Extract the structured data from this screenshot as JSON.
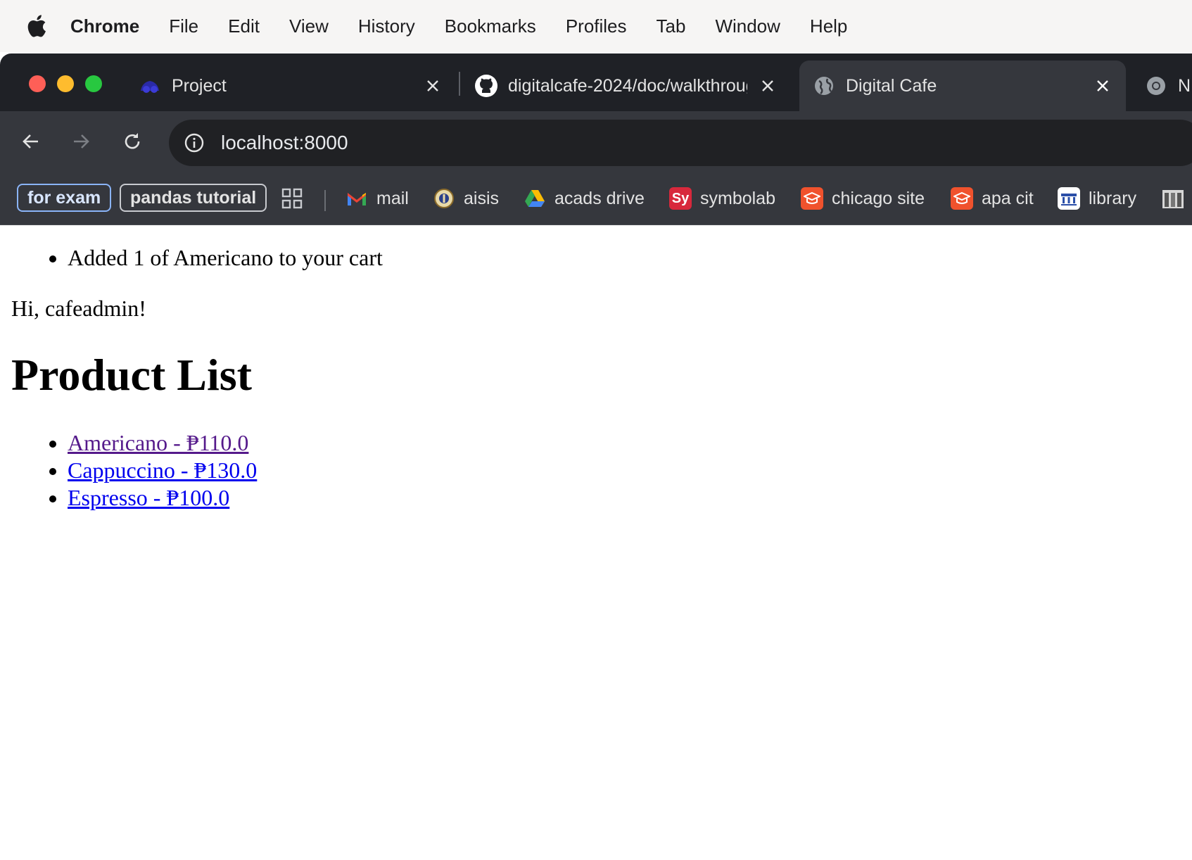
{
  "menubar": {
    "app": "Chrome",
    "items": [
      "File",
      "Edit",
      "View",
      "History",
      "Bookmarks",
      "Profiles",
      "Tab",
      "Window",
      "Help"
    ]
  },
  "tabs": [
    {
      "title": "Project",
      "icon": "project-icon",
      "active": false
    },
    {
      "title": "digitalcafe-2024/doc/walkthrough",
      "icon": "github-icon",
      "active": false
    },
    {
      "title": "Digital Cafe",
      "icon": "globe-icon",
      "active": true
    },
    {
      "title": "N",
      "icon": "chrome-icon",
      "active": false
    }
  ],
  "address_bar": {
    "url": "localhost:8000"
  },
  "bookmarks": {
    "folders": [
      "for exam",
      "pandas tutorial"
    ],
    "items": [
      {
        "label": "mail",
        "icon": "gmail-icon"
      },
      {
        "label": "aisis",
        "icon": "seal-icon"
      },
      {
        "label": "acads drive",
        "icon": "google-drive-icon"
      },
      {
        "label": "symbolab",
        "icon": "symbolab-icon",
        "icon_text": "Sy"
      },
      {
        "label": "chicago site",
        "icon": "graduation-cap-icon"
      },
      {
        "label": "apa cit",
        "icon": "graduation-cap-icon"
      },
      {
        "label": "library",
        "icon": "library-icon"
      }
    ]
  },
  "page": {
    "messages": [
      "Added 1 of Americano to your cart"
    ],
    "greeting": "Hi, cafeadmin!",
    "title": "Product List",
    "products": [
      {
        "label": "Americano - ₱110.0",
        "visited": true
      },
      {
        "label": "Cappuccino - ₱130.0",
        "visited": false
      },
      {
        "label": "Espresso - ₱100.0",
        "visited": false
      }
    ]
  },
  "colors": {
    "tabstrip": "#1f2126",
    "toolbar": "#35373d",
    "link": "#0000ee",
    "visited_link": "#551a8b"
  }
}
